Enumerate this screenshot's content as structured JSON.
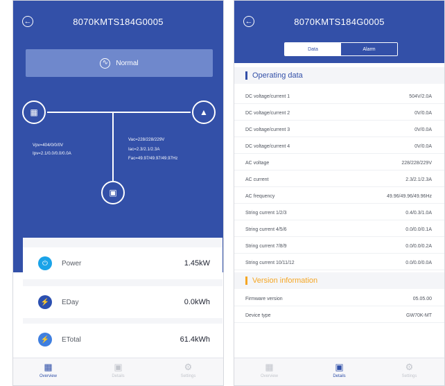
{
  "left": {
    "title": "8070KMTS184G0005",
    "status": {
      "label": "Normal"
    },
    "flow": {
      "pv_lines": [
        "Vpv=404/0/0/0V",
        "Ipv=2.1/0.0/0.0/0.0A"
      ],
      "ac_lines": [
        "Vac=228/228/229V",
        "Iac=2.3/2.1/2.3A",
        "Fac=49.97/49.97/49.97Hz"
      ]
    },
    "summary": [
      {
        "label": "Power",
        "value": "1.45kW"
      },
      {
        "label": "EDay",
        "value": "0.0kWh"
      },
      {
        "label": "ETotal",
        "value": "61.4kWh"
      }
    ],
    "nav": [
      {
        "label": "Overview",
        "active": true
      },
      {
        "label": "Details",
        "active": false
      },
      {
        "label": "Settings",
        "active": false
      }
    ]
  },
  "right": {
    "title": "8070KMTS184G0005",
    "tabs": {
      "data": "Data",
      "alarm": "Alarm"
    },
    "operating": {
      "title": "Operating data",
      "rows": [
        {
          "label": "DC voltage/current 1",
          "value": "504V/2.0A"
        },
        {
          "label": "DC voltage/current 2",
          "value": "0V/0.0A"
        },
        {
          "label": "DC voltage/current 3",
          "value": "0V/0.0A"
        },
        {
          "label": "DC voltage/current 4",
          "value": "0V/0.0A"
        },
        {
          "label": "AC voltage",
          "value": "228/228/229V"
        },
        {
          "label": "AC current",
          "value": "2.3/2.1/2.3A"
        },
        {
          "label": "AC frequency",
          "value": "49.96/49.96/49.96Hz"
        },
        {
          "label": "String current 1/2/3",
          "value": "0.4/0.3/1.0A"
        },
        {
          "label": "String current 4/5/6",
          "value": "0.0/0.0/0.1A"
        },
        {
          "label": "String current 7/8/9",
          "value": "0.0/0.0/0.2A"
        },
        {
          "label": "String current 10/11/12",
          "value": "0.0/0.0/0.0A"
        }
      ]
    },
    "version": {
      "title": "Version information",
      "rows": [
        {
          "label": "Firmware version",
          "value": "05.05.00"
        },
        {
          "label": "Device type",
          "value": "GW70K-MT"
        }
      ]
    },
    "nav": [
      {
        "label": "Overview",
        "active": false
      },
      {
        "label": "Details",
        "active": true
      },
      {
        "label": "Settings",
        "active": false
      }
    ]
  },
  "colors": {
    "primary": "#3350a8",
    "status_panel": "#6f88cc",
    "operating_accent": "#3350a8",
    "version_accent": "#f5a623",
    "icon_power": "#1aa3e8",
    "icon_eday": "#2b4fb0",
    "icon_etotal": "#3f7fe0",
    "nav_active": "#2f4fa8",
    "nav_inactive": "#c2c5cc"
  }
}
